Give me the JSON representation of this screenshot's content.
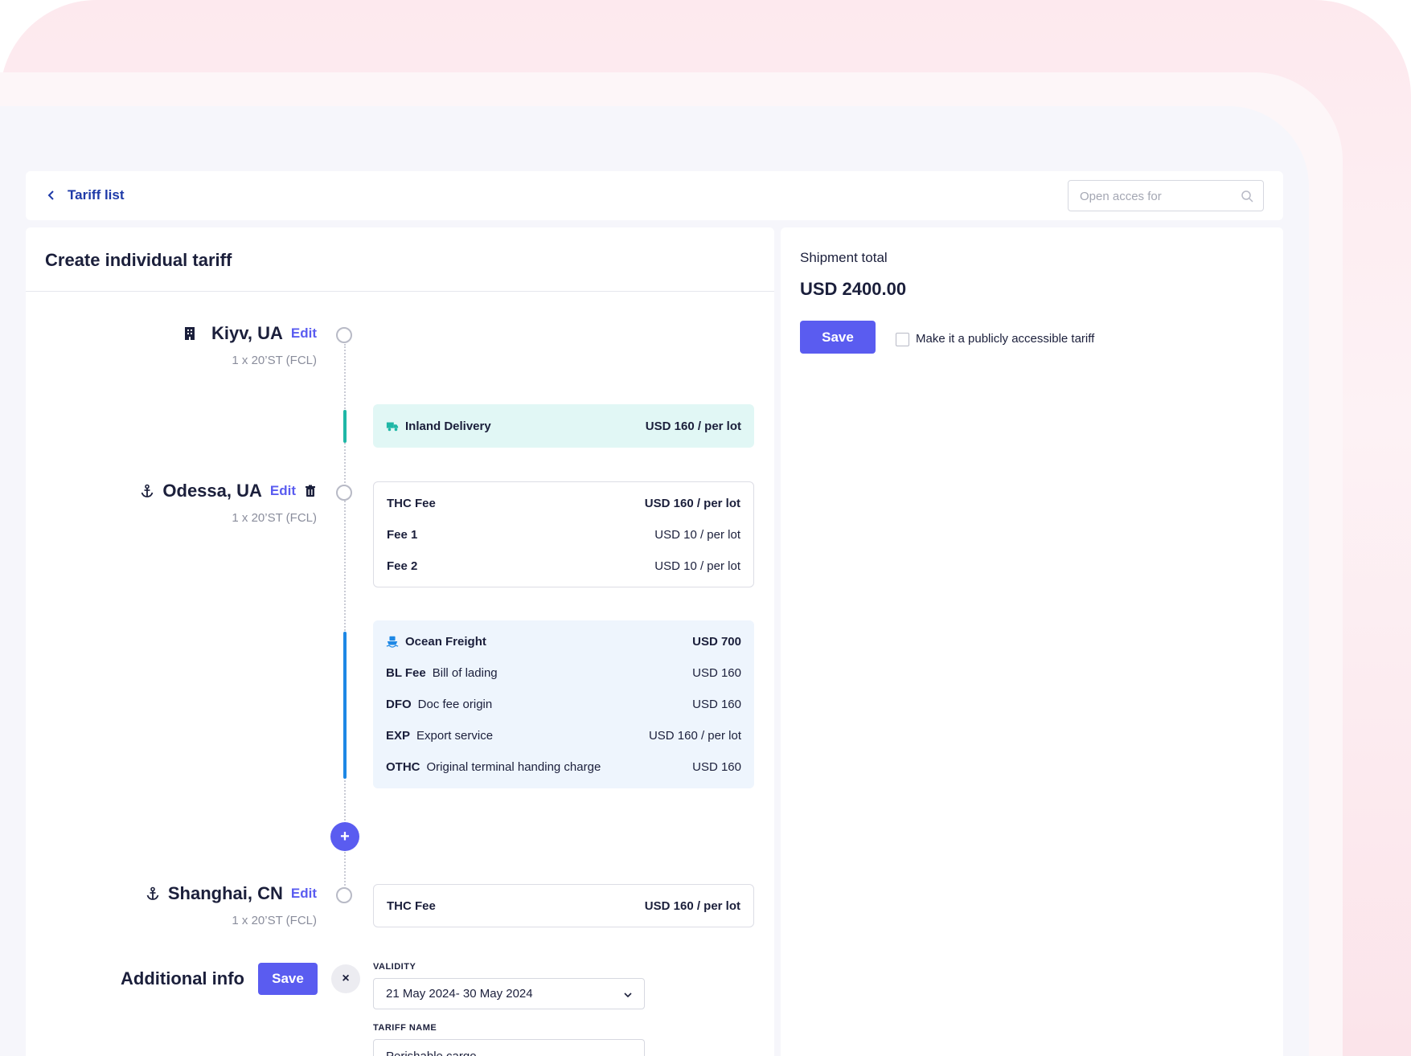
{
  "header": {
    "back_label": "Tariff list",
    "search_placeholder": "Open acces for"
  },
  "main": {
    "title": "Create individual tariff"
  },
  "summary": {
    "label": "Shipment total",
    "total": "USD 2400.00",
    "save_label": "Save",
    "public_label": "Make it a publicly accessible tariff",
    "public_checked": false
  },
  "route": {
    "locations": [
      {
        "name": "Kiyv, UA",
        "edit": "Edit",
        "sub": "1 x 20’ST (FCL)",
        "icon": "building-icon"
      },
      {
        "name": "Odessa, UA",
        "edit": "Edit",
        "sub": "1 x 20’ST (FCL)",
        "icon": "anchor-icon"
      },
      {
        "name": "Shanghai, CN",
        "edit": "Edit",
        "sub": "1 x 20’ST (FCL)",
        "icon": "anchor-icon"
      }
    ],
    "inland": {
      "label": "Inland Delivery",
      "price": "USD 160 / per lot",
      "icon": "truck-icon"
    },
    "odessa_fees": [
      {
        "name": "THC Fee",
        "price": "USD 160 / per lot"
      },
      {
        "name": "Fee 1",
        "price": "USD 10 / per lot"
      },
      {
        "name": "Fee 2",
        "price": "USD 10 / per lot"
      }
    ],
    "ocean": {
      "label": "Ocean Freight",
      "total": "USD 700",
      "icon": "ship-icon",
      "items": [
        {
          "code": "BL Fee",
          "desc": "Bill of lading",
          "price": "USD 160"
        },
        {
          "code": "DFO",
          "desc": "Doc fee origin",
          "price": "USD 160"
        },
        {
          "code": "EXP",
          "desc": "Export service",
          "price": "USD 160 / per lot"
        },
        {
          "code": "OTHC",
          "desc": "Original terminal handing charge",
          "price": "USD 160"
        }
      ]
    },
    "add_label": "+",
    "shanghai_fees": [
      {
        "name": "THC Fee",
        "price": "USD 160 / per lot"
      }
    ]
  },
  "additional": {
    "title": "Additional info",
    "save_label": "Save",
    "close_label": "×",
    "validity_label": "VALIDITY",
    "validity_value": "21 May 2024- 30 May 2024",
    "tariff_name_label": "TARIFF NAME",
    "tariff_name_value": "Perishable cargo"
  },
  "colors": {
    "accent": "#5a5cf0",
    "inland_bar": "#1fb7a6",
    "ocean_bar": "#1e88e5",
    "link": "#1e3aa8"
  }
}
